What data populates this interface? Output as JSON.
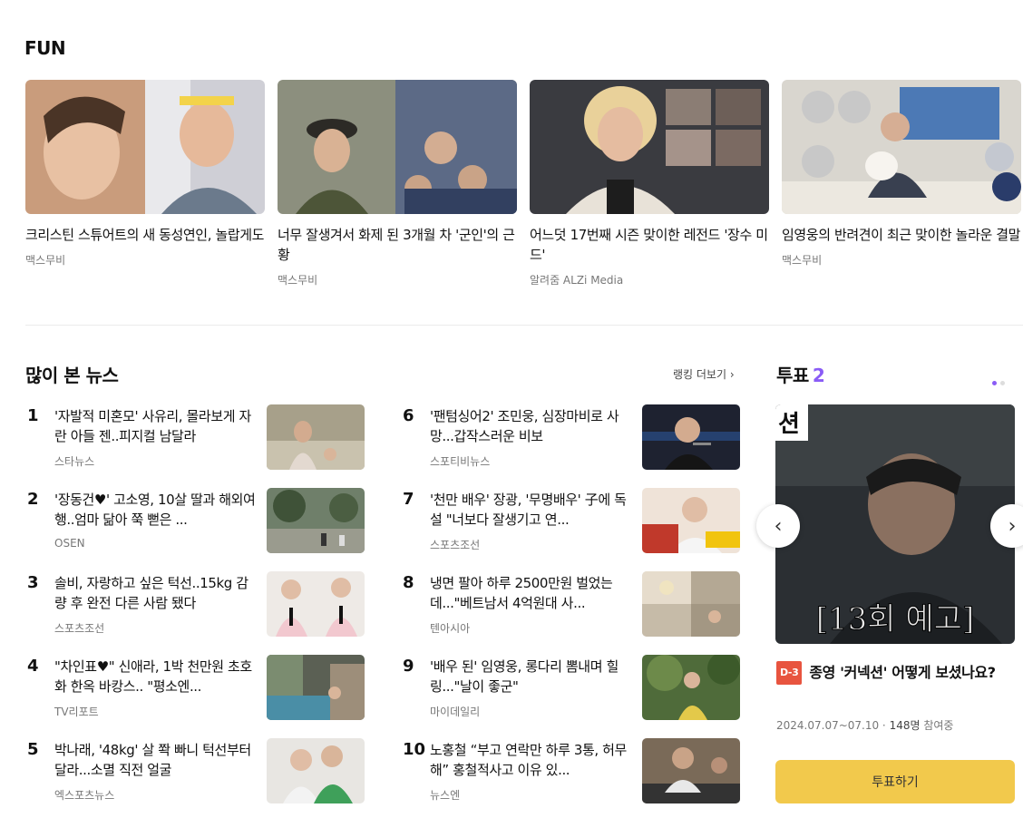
{
  "fun": {
    "title": "FUN",
    "cards": [
      {
        "caption": "크리스틴 스튜어트의 새 동성연인, 놀랍게도",
        "source": "맥스무비"
      },
      {
        "caption": "너무 잘생겨서 화제 된 3개월 차 '군인'의 근황",
        "source": "맥스무비"
      },
      {
        "caption": "어느덧 17번째 시즌 맞이한 레전드 '장수 미드'",
        "source": "알려줌 ALZi Media"
      },
      {
        "caption": "임영웅의 반려견이 최근 맞이한 놀라운 결말",
        "source": "맥스무비"
      }
    ]
  },
  "news": {
    "title": "많이 본 뉴스",
    "more": "랭킹 더보기 ›",
    "items": [
      {
        "rank": "1",
        "text": "'자발적 미혼모' 사유리, 몰라보게 자란 아들 젠..피지컬 남달라",
        "source": "스타뉴스"
      },
      {
        "rank": "2",
        "text": "'장동건♥' 고소영, 10살 딸과 해외여행..엄마 닮아 쭉 뻗은 ...",
        "source": "OSEN"
      },
      {
        "rank": "3",
        "text": "솔비, 자랑하고 싶은 턱선..15kg 감량 후 완전 다른 사람 됐다",
        "source": "스포츠조선"
      },
      {
        "rank": "4",
        "text": "\"차인표♥\" 신애라, 1박 천만원 초호화 한옥 바캉스.. \"평소엔...",
        "source": "TV리포트"
      },
      {
        "rank": "5",
        "text": "박나래, '48kg' 살 쫙 빠니 턱선부터 달라...소멸 직전 얼굴",
        "source": "엑스포츠뉴스"
      },
      {
        "rank": "6",
        "text": "'팬텀싱어2' 조민웅, 심장마비로 사망...갑작스러운 비보",
        "source": "스포티비뉴스"
      },
      {
        "rank": "7",
        "text": "'천만 배우' 장광, '무명배우' 子에 독설 \"너보다 잘생기고 연...",
        "source": "스포츠조선"
      },
      {
        "rank": "8",
        "text": "냉면 팔아 하루 2500만원 벌었는데...\"베트남서 4억원대 사...",
        "source": "텐아시아"
      },
      {
        "rank": "9",
        "text": "'배우 된' 임영웅, 롱다리 뽐내며 힐링...\"날이 좋군\"",
        "source": "마이데일리"
      },
      {
        "rank": "10",
        "text": "노홍철 “부고 연락만 하루 3통, 허무해” 홍철적사고 이유 있...",
        "source": "뉴스엔"
      }
    ]
  },
  "vote": {
    "title": "투표",
    "count": "2",
    "image_text": "[13회 예고]",
    "image_corner_text": "션",
    "dday": "D-3",
    "question": "종영 '커넥션' 어떻게 보셨나요?",
    "period": "2024.07.07~07.10 · ",
    "participants": "148명",
    "participants_suffix": " 참여중",
    "button": "투표하기",
    "prev": "‹",
    "next": "›"
  }
}
